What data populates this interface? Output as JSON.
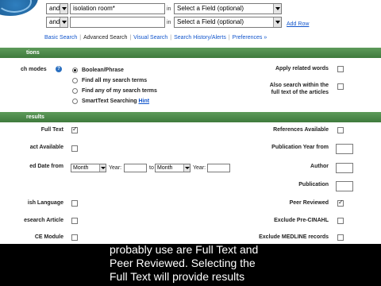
{
  "search": {
    "row1": {
      "operator": "and",
      "term": "isolation room*",
      "in_label": "in",
      "field": "Select a Field (optional)"
    },
    "row2": {
      "operator": "and",
      "term": "",
      "in_label": "in",
      "field": "Select a Field (optional)",
      "add_row": "Add Row"
    },
    "tabs": [
      "Basic Search",
      "Advanced Search",
      "Visual Search",
      "Search History/Alerts",
      "Preferences »"
    ]
  },
  "options": {
    "header": "tions",
    "search_modes_label": "ch modes",
    "modes": [
      "Boolean/Phrase",
      "Find all my search terms",
      "Find any of my search terms",
      "SmartText Searching"
    ],
    "hint": "Hint",
    "apply_related": "Apply related words",
    "full_text_search_1": "Also search within the",
    "full_text_search_2": "full text of the articles"
  },
  "limits": {
    "header": "results",
    "full_text": "Full Text",
    "abstract": "act Available",
    "date_label": "ed Date from",
    "month_from": "Month",
    "year_label": "Year:",
    "to_label": "to",
    "month_to": "Month",
    "year_label2": "Year:",
    "english": "ish Language",
    "research": "esearch Article",
    "ce_module": "CE Module",
    "references": "References Available",
    "pub_year": "Publication Year from",
    "author": "Author",
    "publication": "Publication",
    "peer_reviewed": "Peer Reviewed",
    "exclude_pre": "Exclude Pre-CINAHL",
    "exclude_medline": "Exclude MEDLINE records"
  },
  "caption": {
    "line1": "probably use are Full Text and",
    "line2": "Peer Reviewed. Selecting the",
    "line3": "Full Text will provide results"
  }
}
